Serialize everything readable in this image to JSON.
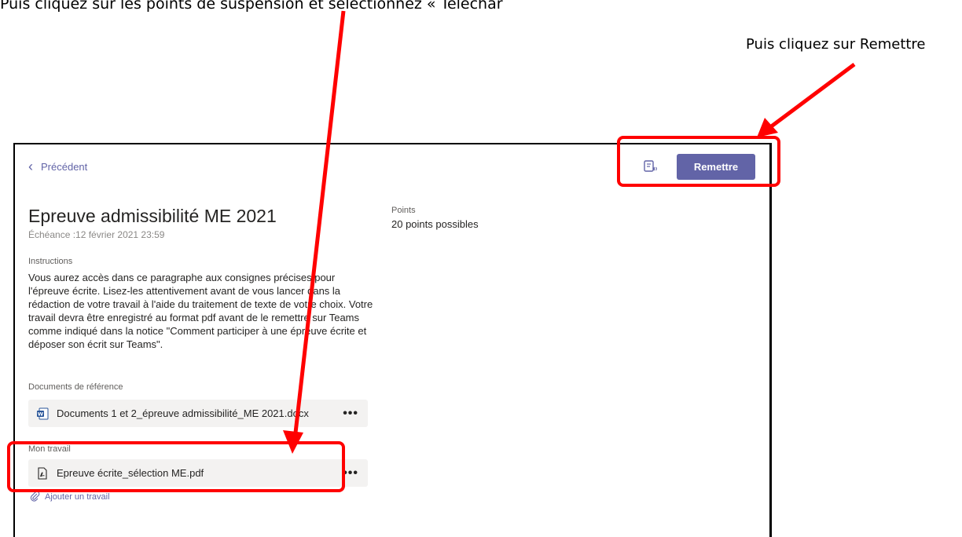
{
  "annotations": {
    "top_note": "Puis cliquez sur les points de suspension et sélectionnez « Télécharger »",
    "hint": "Puis cliquez sur Remettre"
  },
  "header": {
    "back_label": "Précédent",
    "back_icon": "chevron-left-icon",
    "reader_icon": "immersive-reader-icon",
    "submit_label": "Remettre"
  },
  "assignment": {
    "title": "Epreuve admissibilité ME 2021",
    "due": "Échéance :12 février 2021 23:59",
    "points_label": "Points",
    "points_value": "20 points possibles",
    "instructions_label": "Instructions",
    "instructions_text": "Vous aurez accès dans ce paragraphe aux consignes précises pour l'épreuve écrite. Lisez-les attentivement avant de vous lancer dans la rédaction de votre travail à l'aide du traitement de texte de votre choix. Votre travail devra être enregistré au format pdf avant de le remettre sur Teams comme indiqué dans la notice \"Comment participer à une épreuve écrite et déposer son écrit sur Teams\"."
  },
  "reference_docs": {
    "label": "Documents de référence",
    "files": [
      {
        "name": "Documents 1 et 2_épreuve admissibilité_ME 2021.docx",
        "icon": "word-doc-icon",
        "more": "•••"
      }
    ]
  },
  "my_work": {
    "label": "Mon travail",
    "files": [
      {
        "name": "Epreuve écrite_sélection ME.pdf",
        "icon": "pdf-file-icon",
        "more": "•••"
      }
    ],
    "add_label": "Ajouter un travail",
    "add_icon": "paperclip-icon"
  },
  "colors": {
    "accent": "#6264a7",
    "annotation": "#ff0000",
    "card": "#f3f2f1"
  }
}
